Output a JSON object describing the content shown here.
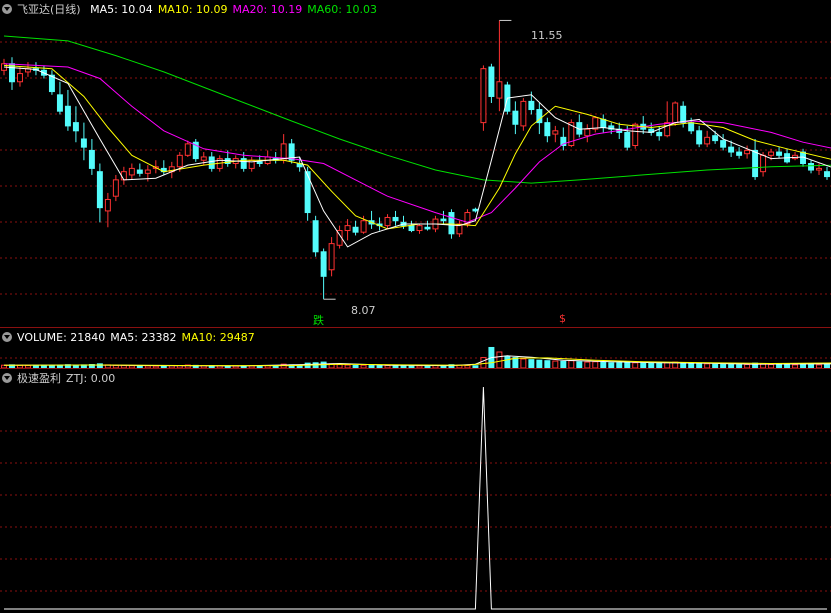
{
  "price_panel": {
    "stock_name": "飞亚达",
    "period": "(日线)",
    "indicators": [
      {
        "label": "MA5: 10.04",
        "color": "#ffffff"
      },
      {
        "label": "MA10: 10.09",
        "color": "#ffff00"
      },
      {
        "label": "MA20: 10.19",
        "color": "#ff00ff"
      },
      {
        "label": "MA60: 10.03",
        "color": "#00e000"
      }
    ],
    "high_label": "11.55",
    "low_label": "8.07",
    "signal_down": "跌",
    "signal_up": "$"
  },
  "volume_panel": {
    "indicators": [
      {
        "label": "VOLUME: 21840",
        "color": "#ffffff"
      },
      {
        "label": "MA5: 23382",
        "color": "#ffffff"
      },
      {
        "label": "MA10: 29487",
        "color": "#ffff00"
      }
    ]
  },
  "indicator_panel": {
    "name": "极速盈利",
    "label": "ZTJ: 0.00"
  },
  "colors": {
    "up": "#ff3232",
    "down": "#54fcfc",
    "grid": "#8a1010",
    "ma5": "#ffffff",
    "ma10": "#ffff00",
    "ma20": "#ff00ff",
    "ma60": "#00e000"
  },
  "chart_data": {
    "type": "candlestick",
    "y_range": [
      7.8,
      11.8
    ],
    "candles": [
      [
        10.94,
        11.08,
        10.88,
        11.02
      ],
      [
        11.02,
        11.1,
        10.7,
        10.8
      ],
      [
        10.8,
        10.98,
        10.74,
        10.9
      ],
      [
        10.92,
        11.04,
        10.86,
        10.96
      ],
      [
        10.96,
        11.04,
        10.88,
        10.94
      ],
      [
        10.94,
        11.0,
        10.84,
        10.88
      ],
      [
        10.88,
        10.94,
        10.64,
        10.68
      ],
      [
        10.64,
        10.8,
        10.4,
        10.44
      ],
      [
        10.5,
        10.7,
        10.2,
        10.26
      ],
      [
        10.3,
        10.5,
        10.06,
        10.2
      ],
      [
        10.1,
        10.3,
        9.84,
        10.0
      ],
      [
        9.96,
        10.1,
        9.66,
        9.74
      ],
      [
        9.7,
        9.8,
        9.08,
        9.26
      ],
      [
        9.22,
        9.44,
        9.02,
        9.36
      ],
      [
        9.4,
        9.66,
        9.34,
        9.6
      ],
      [
        9.6,
        9.76,
        9.54,
        9.7
      ],
      [
        9.66,
        9.8,
        9.6,
        9.74
      ],
      [
        9.72,
        9.8,
        9.64,
        9.68
      ],
      [
        9.68,
        9.78,
        9.58,
        9.72
      ],
      [
        9.74,
        9.84,
        9.68,
        9.76
      ],
      [
        9.74,
        9.84,
        9.66,
        9.7
      ],
      [
        9.7,
        9.82,
        9.62,
        9.76
      ],
      [
        9.76,
        9.94,
        9.7,
        9.9
      ],
      [
        9.9,
        10.08,
        9.88,
        10.04
      ],
      [
        10.06,
        10.1,
        9.82,
        9.86
      ],
      [
        9.84,
        9.94,
        9.78,
        9.88
      ],
      [
        9.88,
        9.94,
        9.7,
        9.74
      ],
      [
        9.74,
        9.9,
        9.7,
        9.86
      ],
      [
        9.86,
        9.96,
        9.76,
        9.8
      ],
      [
        9.8,
        9.9,
        9.74,
        9.86
      ],
      [
        9.86,
        9.94,
        9.7,
        9.74
      ],
      [
        9.74,
        9.88,
        9.7,
        9.84
      ],
      [
        9.82,
        9.9,
        9.76,
        9.8
      ],
      [
        9.8,
        9.96,
        9.78,
        9.88
      ],
      [
        9.86,
        9.94,
        9.8,
        9.84
      ],
      [
        9.84,
        10.16,
        9.8,
        10.04
      ],
      [
        10.04,
        10.1,
        9.8,
        9.84
      ],
      [
        9.8,
        9.88,
        9.7,
        9.76
      ],
      [
        9.7,
        9.76,
        9.1,
        9.2
      ],
      [
        9.1,
        9.16,
        8.66,
        8.72
      ],
      [
        8.72,
        8.76,
        8.14,
        8.42
      ],
      [
        8.5,
        8.9,
        8.42,
        8.82
      ],
      [
        8.8,
        9.04,
        8.76,
        8.98
      ],
      [
        8.98,
        9.12,
        8.86,
        9.04
      ],
      [
        9.02,
        9.1,
        8.92,
        8.96
      ],
      [
        8.96,
        9.16,
        8.94,
        9.1
      ],
      [
        9.1,
        9.22,
        9.0,
        9.06
      ],
      [
        9.06,
        9.14,
        8.98,
        9.04
      ],
      [
        9.04,
        9.18,
        9.0,
        9.14
      ],
      [
        9.14,
        9.22,
        9.04,
        9.1
      ],
      [
        9.08,
        9.16,
        9.0,
        9.04
      ],
      [
        9.04,
        9.1,
        8.96,
        8.98
      ],
      [
        8.98,
        9.06,
        8.94,
        9.04
      ],
      [
        9.02,
        9.1,
        8.98,
        9.0
      ],
      [
        9.0,
        9.16,
        8.96,
        9.12
      ],
      [
        9.12,
        9.22,
        9.06,
        9.1
      ],
      [
        9.2,
        9.24,
        8.88,
        8.94
      ],
      [
        8.94,
        9.1,
        8.9,
        9.06
      ],
      [
        9.06,
        9.24,
        9.02,
        9.2
      ],
      [
        9.24,
        9.26,
        9.2,
        9.22
      ],
      [
        10.3,
        11.0,
        10.2,
        10.96
      ],
      [
        10.98,
        11.02,
        10.54,
        10.62
      ],
      [
        10.6,
        11.55,
        10.44,
        10.8
      ],
      [
        10.76,
        10.8,
        10.4,
        10.44
      ],
      [
        10.44,
        10.56,
        10.16,
        10.28
      ],
      [
        10.26,
        10.6,
        10.2,
        10.56
      ],
      [
        10.56,
        10.68,
        10.4,
        10.46
      ],
      [
        10.46,
        10.54,
        10.16,
        10.3
      ],
      [
        10.3,
        10.36,
        10.06,
        10.14
      ],
      [
        10.16,
        10.26,
        10.06,
        10.2
      ],
      [
        10.12,
        10.24,
        9.96,
        10.02
      ],
      [
        10.02,
        10.34,
        10.0,
        10.3
      ],
      [
        10.3,
        10.4,
        10.12,
        10.16
      ],
      [
        10.14,
        10.28,
        10.06,
        10.22
      ],
      [
        10.22,
        10.38,
        10.18,
        10.36
      ],
      [
        10.34,
        10.4,
        10.18,
        10.24
      ],
      [
        10.26,
        10.3,
        10.16,
        10.22
      ],
      [
        10.22,
        10.3,
        10.1,
        10.18
      ],
      [
        10.18,
        10.26,
        9.96,
        10.0
      ],
      [
        10.02,
        10.3,
        9.98,
        10.28
      ],
      [
        10.28,
        10.38,
        10.16,
        10.22
      ],
      [
        10.22,
        10.3,
        10.14,
        10.18
      ],
      [
        10.18,
        10.26,
        10.08,
        10.14
      ],
      [
        10.14,
        10.56,
        10.12,
        10.3
      ],
      [
        10.3,
        10.56,
        10.26,
        10.54
      ],
      [
        10.5,
        10.56,
        10.24,
        10.3
      ],
      [
        10.3,
        10.36,
        10.16,
        10.2
      ],
      [
        10.2,
        10.26,
        10.0,
        10.04
      ],
      [
        10.04,
        10.2,
        10.0,
        10.12
      ],
      [
        10.14,
        10.2,
        10.04,
        10.08
      ],
      [
        10.08,
        10.16,
        9.96,
        10.0
      ],
      [
        10.0,
        10.08,
        9.88,
        9.94
      ],
      [
        9.94,
        10.0,
        9.86,
        9.9
      ],
      [
        9.92,
        10.02,
        9.86,
        9.96
      ],
      [
        9.96,
        10.1,
        9.6,
        9.64
      ],
      [
        9.7,
        9.94,
        9.64,
        9.9
      ],
      [
        9.9,
        9.98,
        9.84,
        9.94
      ],
      [
        9.94,
        10.0,
        9.86,
        9.9
      ],
      [
        9.92,
        9.98,
        9.8,
        9.82
      ],
      [
        9.86,
        9.94,
        9.84,
        9.9
      ],
      [
        9.94,
        9.98,
        9.76,
        9.8
      ],
      [
        9.8,
        9.84,
        9.68,
        9.72
      ],
      [
        9.72,
        9.8,
        9.66,
        9.74
      ],
      [
        9.7,
        9.76,
        9.6,
        9.64
      ]
    ],
    "ma5": [
      [
        0,
        10.98
      ],
      [
        4,
        10.95
      ],
      [
        8,
        10.78
      ],
      [
        12,
        10.1
      ],
      [
        15,
        9.6
      ],
      [
        19,
        9.62
      ],
      [
        23,
        9.78
      ],
      [
        27,
        9.84
      ],
      [
        31,
        9.82
      ],
      [
        35,
        9.86
      ],
      [
        37,
        9.88
      ],
      [
        40,
        9.22
      ],
      [
        43,
        8.78
      ],
      [
        46,
        8.94
      ],
      [
        50,
        9.06
      ],
      [
        54,
        9.06
      ],
      [
        57,
        9.04
      ],
      [
        59,
        9.1
      ],
      [
        61,
        9.84
      ],
      [
        63,
        10.6
      ],
      [
        66,
        10.64
      ],
      [
        69,
        10.36
      ],
      [
        72,
        10.22
      ],
      [
        75,
        10.24
      ],
      [
        78,
        10.2
      ],
      [
        81,
        10.18
      ],
      [
        84,
        10.3
      ],
      [
        87,
        10.34
      ],
      [
        90,
        10.1
      ],
      [
        93,
        9.98
      ],
      [
        96,
        9.86
      ],
      [
        100,
        9.88
      ],
      [
        104,
        9.74
      ]
    ],
    "ma10": [
      [
        0,
        11.0
      ],
      [
        6,
        10.96
      ],
      [
        10,
        10.62
      ],
      [
        13,
        10.24
      ],
      [
        16,
        9.9
      ],
      [
        20,
        9.7
      ],
      [
        25,
        9.78
      ],
      [
        30,
        9.84
      ],
      [
        35,
        9.84
      ],
      [
        38,
        9.78
      ],
      [
        41,
        9.46
      ],
      [
        44,
        9.16
      ],
      [
        48,
        9.0
      ],
      [
        52,
        9.06
      ],
      [
        56,
        9.06
      ],
      [
        59,
        9.04
      ],
      [
        62,
        9.5
      ],
      [
        64,
        9.92
      ],
      [
        66,
        10.26
      ],
      [
        69,
        10.5
      ],
      [
        73,
        10.4
      ],
      [
        77,
        10.28
      ],
      [
        81,
        10.24
      ],
      [
        86,
        10.3
      ],
      [
        90,
        10.24
      ],
      [
        94,
        10.08
      ],
      [
        98,
        9.98
      ],
      [
        104,
        9.84
      ]
    ],
    "ma20": [
      [
        0,
        11.02
      ],
      [
        8,
        10.98
      ],
      [
        12,
        10.84
      ],
      [
        16,
        10.5
      ],
      [
        20,
        10.2
      ],
      [
        25,
        9.98
      ],
      [
        30,
        9.9
      ],
      [
        36,
        9.86
      ],
      [
        40,
        9.8
      ],
      [
        44,
        9.6
      ],
      [
        48,
        9.4
      ],
      [
        54,
        9.2
      ],
      [
        58,
        9.08
      ],
      [
        61,
        9.2
      ],
      [
        64,
        9.5
      ],
      [
        67,
        9.82
      ],
      [
        70,
        10.04
      ],
      [
        74,
        10.16
      ],
      [
        78,
        10.22
      ],
      [
        82,
        10.28
      ],
      [
        86,
        10.32
      ],
      [
        90,
        10.3
      ],
      [
        96,
        10.18
      ],
      [
        100,
        10.06
      ],
      [
        104,
        9.98
      ]
    ],
    "ma60": [
      [
        0,
        11.36
      ],
      [
        8,
        11.3
      ],
      [
        14,
        11.12
      ],
      [
        20,
        10.92
      ],
      [
        28,
        10.62
      ],
      [
        36,
        10.32
      ],
      [
        42,
        10.1
      ],
      [
        48,
        9.9
      ],
      [
        54,
        9.72
      ],
      [
        60,
        9.6
      ],
      [
        66,
        9.56
      ],
      [
        72,
        9.6
      ],
      [
        80,
        9.66
      ],
      [
        88,
        9.72
      ],
      [
        96,
        9.76
      ],
      [
        104,
        9.78
      ]
    ],
    "volume_range": [
      0,
      230000
    ],
    "volume": [
      16000,
      18000,
      15000,
      14000,
      13000,
      15000,
      14000,
      17000,
      19000,
      16000,
      18000,
      20000,
      24000,
      18000,
      15000,
      14000,
      13000,
      12000,
      12000,
      11000,
      12000,
      13000,
      14000,
      17000,
      15000,
      13000,
      13000,
      12000,
      12000,
      11000,
      12000,
      12000,
      11000,
      13000,
      12000,
      22000,
      18000,
      16000,
      28000,
      30000,
      34000,
      24000,
      20000,
      17000,
      15000,
      16000,
      14000,
      13000,
      14000,
      13000,
      12000,
      13000,
      12000,
      12000,
      14000,
      13000,
      19000,
      16000,
      14000,
      13000,
      60000,
      118000,
      92000,
      68000,
      60000,
      52000,
      48000,
      45000,
      42000,
      40000,
      38000,
      42000,
      36000,
      34000,
      36000,
      32000,
      30000,
      30000,
      32000,
      30000,
      28000,
      26000,
      26000,
      30000,
      34000,
      28000,
      26000,
      28000,
      24000,
      22000,
      22000,
      20000,
      19000,
      20000,
      28000,
      22000,
      20000,
      19000,
      20000,
      18000,
      20000,
      19000,
      18000,
      21840
    ],
    "vol_ma5": [
      [
        0,
        16000
      ],
      [
        10,
        17000
      ],
      [
        20,
        14000
      ],
      [
        30,
        12000
      ],
      [
        38,
        20000
      ],
      [
        42,
        26000
      ],
      [
        48,
        16000
      ],
      [
        56,
        14000
      ],
      [
        59,
        22000
      ],
      [
        61,
        60000
      ],
      [
        63,
        70000
      ],
      [
        66,
        62000
      ],
      [
        70,
        45000
      ],
      [
        76,
        36000
      ],
      [
        82,
        30000
      ],
      [
        88,
        27000
      ],
      [
        94,
        22000
      ],
      [
        104,
        23382
      ]
    ],
    "vol_ma10": [
      [
        0,
        16000
      ],
      [
        12,
        17000
      ],
      [
        24,
        14000
      ],
      [
        36,
        14000
      ],
      [
        42,
        22000
      ],
      [
        50,
        18000
      ],
      [
        58,
        16000
      ],
      [
        61,
        30000
      ],
      [
        64,
        56000
      ],
      [
        68,
        58000
      ],
      [
        74,
        44000
      ],
      [
        80,
        36000
      ],
      [
        88,
        30000
      ],
      [
        96,
        26000
      ],
      [
        104,
        29487
      ]
    ],
    "ztj": {
      "range": [
        0,
        1
      ],
      "spike_index": 60,
      "spike_value": 1
    }
  }
}
